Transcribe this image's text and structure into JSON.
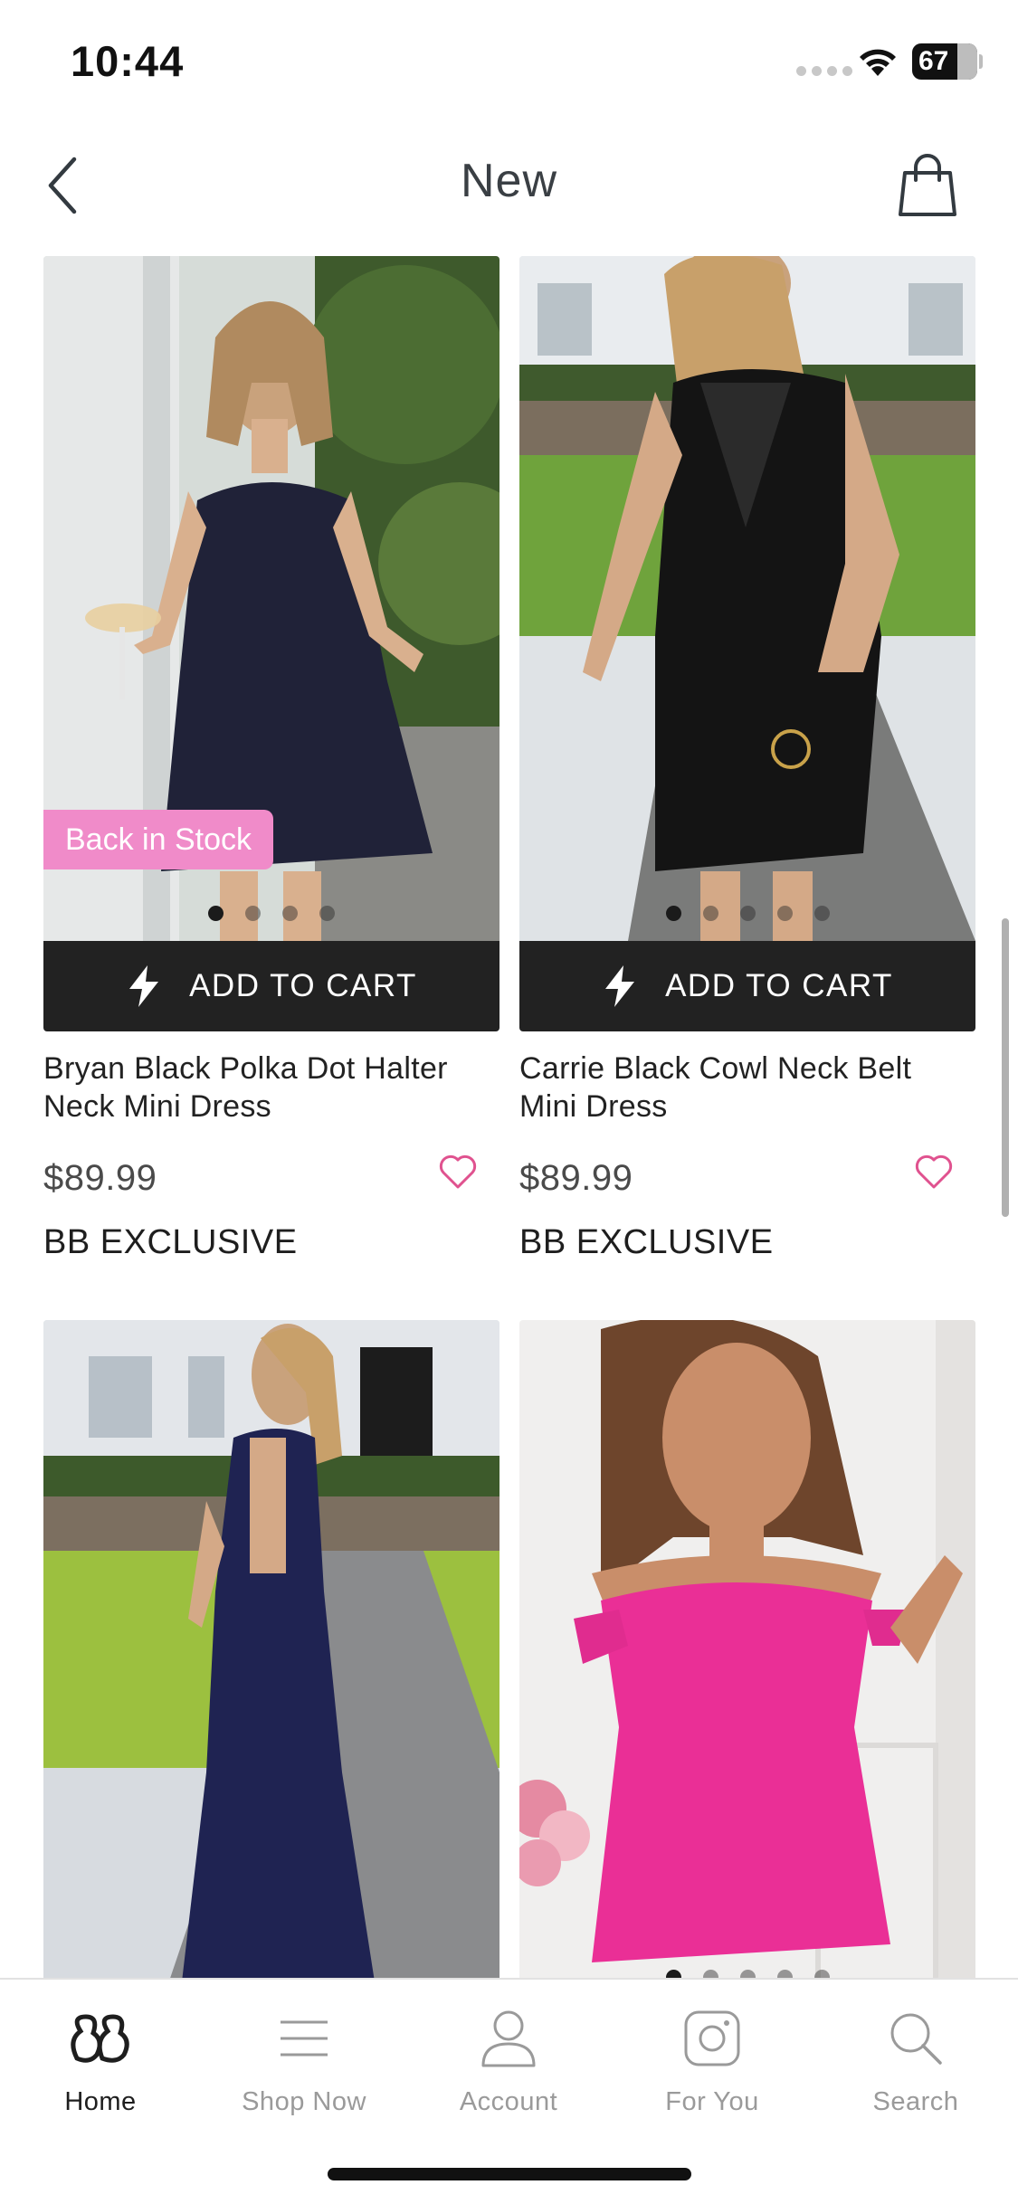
{
  "status_bar": {
    "time": "10:44",
    "battery": "67"
  },
  "header": {
    "title": "New",
    "back_icon": "chevron-left-icon",
    "bag_icon": "shopping-bag-icon"
  },
  "products": [
    {
      "name": "Bryan Black Polka Dot Halter Neck Mini Dress",
      "price": "$89.99",
      "tag": "BB EXCLUSIVE",
      "badge": "Back in Stock",
      "cart_label": "ADD TO CART",
      "image_count": 4,
      "active_image": 0
    },
    {
      "name": "Carrie Black Cowl Neck Belt Mini Dress",
      "price": "$89.99",
      "tag": "BB EXCLUSIVE",
      "badge": "",
      "cart_label": "ADD TO CART",
      "image_count": 5,
      "active_image": 0
    },
    {
      "name": "",
      "price": "",
      "tag": "",
      "badge": "",
      "cart_label": "",
      "image_count": 0,
      "active_image": 0
    },
    {
      "name": "",
      "price": "",
      "tag": "",
      "badge": "",
      "cart_label": "",
      "image_count": 5,
      "active_image": 0
    }
  ],
  "tabbar": {
    "items": [
      {
        "label": "Home",
        "icon": "brand-logo-icon",
        "active": true
      },
      {
        "label": "Shop Now",
        "icon": "menu-icon",
        "active": false
      },
      {
        "label": "Account",
        "icon": "user-icon",
        "active": false
      },
      {
        "label": "For You",
        "icon": "instagram-icon",
        "active": false
      },
      {
        "label": "Search",
        "icon": "search-icon",
        "active": false
      }
    ]
  },
  "colors": {
    "accent_pink": "#f08bc9",
    "cart_button": "#222222",
    "heart": "#e0528f"
  }
}
